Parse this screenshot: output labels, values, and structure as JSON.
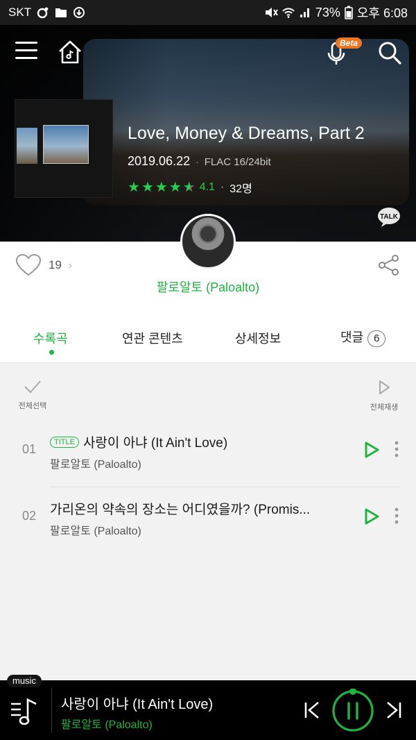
{
  "status_bar": {
    "carrier": "SKT",
    "battery": "73%",
    "time": "오후 6:08"
  },
  "header": {
    "beta_badge": "Beta"
  },
  "album": {
    "title": "Love, Money & Dreams, Part 2",
    "release_date": "2019.06.22",
    "format": "FLAC 16/24bit",
    "rating": "4.1",
    "rating_value": 4.1,
    "rating_count": "32명",
    "like_count": "19",
    "artist": "팔로알토 (Paloalto)",
    "talk_label": "TALK"
  },
  "tabs": [
    {
      "label": "수록곡",
      "active": true
    },
    {
      "label": "연관 콘텐츠",
      "active": false
    },
    {
      "label": "상세정보",
      "active": false
    },
    {
      "label": "댓글",
      "active": false,
      "badge": "6"
    }
  ],
  "list_controls": {
    "select_all": "전체선택",
    "play_all": "전체재생"
  },
  "tracks": [
    {
      "number": "01",
      "badge": "TITLE",
      "title": "사랑이 아냐 (It Ain't Love)",
      "artist": "팔로알토 (Paloalto)"
    },
    {
      "number": "02",
      "title": "가리온의 약속의 장소는 어디였을까? (Promis...",
      "artist": "팔로알토 (Paloalto)"
    }
  ],
  "player": {
    "label": "music",
    "title": "사랑이 아냐 (It Ain't Love)",
    "artist": "팔로알토 (Paloalto)"
  },
  "colors": {
    "accent": "#1fb33f",
    "beta": "#f07522"
  }
}
